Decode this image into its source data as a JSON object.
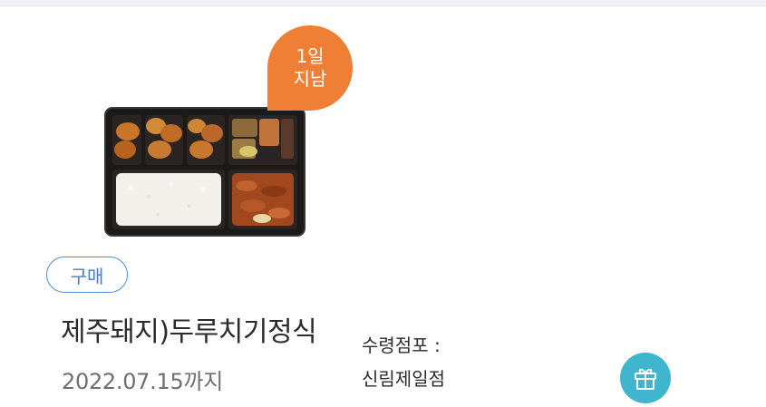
{
  "coupon": {
    "elapsed_badge": {
      "line1": "1일",
      "line2": "지남",
      "color": "#f07f36"
    },
    "product_image_icon": "lunchbox-image",
    "type_tag": "구매",
    "product_name": "제주돼지)두루치기정식",
    "expiry": "2022.07.15까지",
    "store_label": "수령점포 :",
    "store_name": "신림제일점",
    "gift_icon": "gift-icon",
    "colors": {
      "accent_blue": "#4a8de0",
      "gift_teal": "#3fb6ce"
    }
  }
}
